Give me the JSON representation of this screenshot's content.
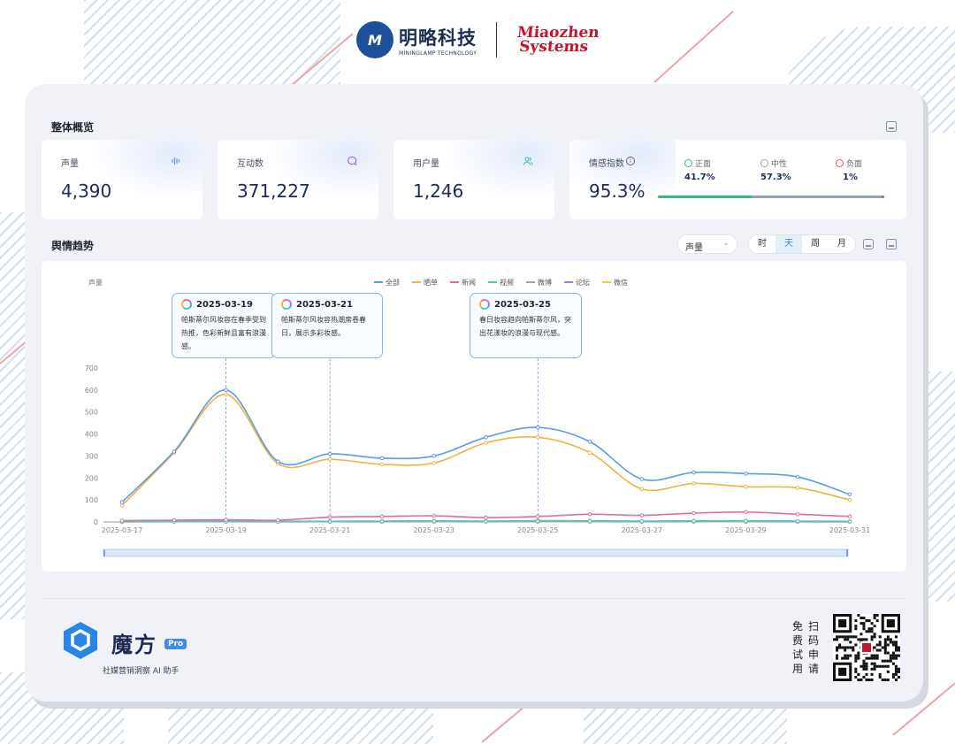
{
  "brand": {
    "minglue_cn": "明略科技",
    "minglue_en": "MININGLAMP TECHNOLOGY",
    "miaozhen_line1": "Miaozhen",
    "miaozhen_line2": "Systems"
  },
  "overview": {
    "title": "整体概览",
    "kpis": [
      {
        "label": "声量",
        "value": "4,390",
        "icon": "sound-wave-icon",
        "color": "#6b8fe0"
      },
      {
        "label": "互动数",
        "value": "371,227",
        "icon": "chat-bubble-icon",
        "color": "#9b6be0"
      },
      {
        "label": "用户量",
        "value": "1,246",
        "icon": "users-icon",
        "color": "#3fc1b0"
      }
    ],
    "sentiment": {
      "label": "情感指数",
      "value": "95.3%",
      "items": [
        {
          "label": "正面",
          "value": "41.7%",
          "share": 0.417,
          "color": "#2fbf7a"
        },
        {
          "label": "中性",
          "value": "57.3%",
          "share": 0.573,
          "color": "#9aa3b3"
        },
        {
          "label": "负面",
          "value": "1%",
          "share": 0.01,
          "color": "#e05a5a"
        }
      ]
    }
  },
  "trend": {
    "title": "舆情趋势",
    "metric_select": "声量",
    "granularity": [
      "时",
      "天",
      "周",
      "月"
    ],
    "active_granularity": "天"
  },
  "chart_data": {
    "type": "line",
    "ylabel": "声量",
    "ylim": [
      0,
      700
    ],
    "yticks": [
      0,
      100,
      200,
      300,
      400,
      500,
      600,
      700
    ],
    "x": [
      "2025-03-17",
      "2025-03-18",
      "2025-03-19",
      "2025-03-20",
      "2025-03-21",
      "2025-03-22",
      "2025-03-23",
      "2025-03-24",
      "2025-03-25",
      "2025-03-26",
      "2025-03-27",
      "2025-03-28",
      "2025-03-29",
      "2025-03-30",
      "2025-03-31"
    ],
    "xtick_labels": [
      "2025-03-17",
      "2025-03-19",
      "2025-03-21",
      "2025-03-23",
      "2025-03-25",
      "2025-03-27",
      "2025-03-29",
      "2025-03-31"
    ],
    "series": [
      {
        "name": "全部",
        "color": "#5b9be8",
        "values": [
          90,
          320,
          600,
          275,
          310,
          290,
          300,
          385,
          430,
          365,
          195,
          225,
          220,
          205,
          125
        ]
      },
      {
        "name": "晒单",
        "color": "#f2b23e",
        "values": [
          75,
          315,
          580,
          265,
          285,
          262,
          268,
          360,
          385,
          315,
          150,
          175,
          160,
          155,
          100
        ]
      },
      {
        "name": "新闻",
        "color": "#e86aa4",
        "values": [
          6,
          8,
          10,
          8,
          22,
          25,
          28,
          20,
          25,
          35,
          30,
          40,
          45,
          35,
          25
        ]
      },
      {
        "name": "视频",
        "color": "#4ccab9",
        "values": [
          1,
          1,
          2,
          1,
          2,
          2,
          3,
          2,
          3,
          3,
          3,
          4,
          4,
          3,
          2
        ]
      },
      {
        "name": "微博",
        "color": "#9aa3b3",
        "values": [
          2,
          3,
          5,
          3,
          3,
          4,
          5,
          4,
          6,
          5,
          4,
          5,
          5,
          4,
          3
        ]
      },
      {
        "name": "论坛",
        "color": "#a77be0",
        "values": [
          1,
          1,
          1,
          1,
          1,
          1,
          2,
          1,
          2,
          2,
          1,
          2,
          2,
          1,
          1
        ]
      },
      {
        "name": "微信",
        "color": "#e8d23a",
        "values": [
          0,
          1,
          1,
          0,
          1,
          1,
          1,
          1,
          1,
          1,
          1,
          1,
          1,
          1,
          0
        ]
      }
    ],
    "annotations": [
      {
        "date": "2025-03-19",
        "text": "帕斯蒂尔风妆容在春季受到热推，色彩新鲜且富有浪漫感。"
      },
      {
        "date": "2025-03-21",
        "text": "帕斯蒂尔风妆容热潮席卷春日，展示多彩妆感。"
      },
      {
        "date": "2025-03-25",
        "text": "春日妆容趋向帕斯蒂尔风，突出花漾妆的浪漫与现代感。"
      }
    ],
    "legend_position": "top-right"
  },
  "footer": {
    "product_name": "魔方",
    "badge": "Pro",
    "subtitle": "社媒营销洞察 AI 助手",
    "trial_col1": [
      "免",
      "费",
      "试",
      "用"
    ],
    "trial_col2": [
      "扫",
      "码",
      "申",
      "请"
    ]
  }
}
